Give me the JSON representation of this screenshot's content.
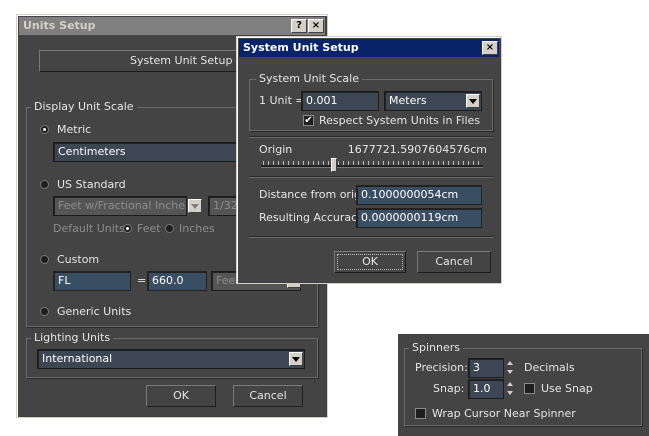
{
  "units_setup": {
    "title": "Units Setup",
    "help_btn": "?",
    "close_btn": "×",
    "system_unit_setup_btn": "System Unit Setup",
    "display_group": "Display Unit Scale",
    "metric_label": "Metric",
    "metric_value": "Centimeters",
    "metric_selected": true,
    "us_label": "US Standard",
    "us_value": "Feet w/Fractional Inches",
    "us_fraction": "1/32",
    "default_units_label": "Default Units:",
    "feet_label": "Feet",
    "inches_label": "Inches",
    "custom_label": "Custom",
    "custom_name": "FL",
    "custom_eq": "=",
    "custom_value": "660.0",
    "custom_unit": "Feet",
    "generic_label": "Generic Units",
    "lighting_group": "Lighting Units",
    "lighting_value": "International",
    "ok": "OK",
    "cancel": "Cancel"
  },
  "system_unit_setup": {
    "title": "System Unit Setup",
    "close_btn": "×",
    "scale_group": "System Unit Scale",
    "unit_label": "1 Unit =",
    "unit_value": "0.001",
    "unit_type": "Meters",
    "respect_label": "Respect System Units in Files",
    "respect_checked": true,
    "origin_label": "Origin",
    "origin_value": "1677721.5907604576cm",
    "distance_label": "Distance from origin:",
    "distance_value": "0.1000000054cm",
    "accuracy_label": "Resulting Accuracy:",
    "accuracy_value": "0.0000000119cm",
    "ok": "OK",
    "cancel": "Cancel"
  },
  "spinners": {
    "group": "Spinners",
    "precision_label": "Precision:",
    "precision_value": "3",
    "decimals_label": "Decimals",
    "snap_label": "Snap:",
    "snap_value": "1.0",
    "use_snap_label": "Use Snap",
    "use_snap_checked": false,
    "wrap_label": "Wrap Cursor Near Spinner",
    "wrap_checked": false
  }
}
